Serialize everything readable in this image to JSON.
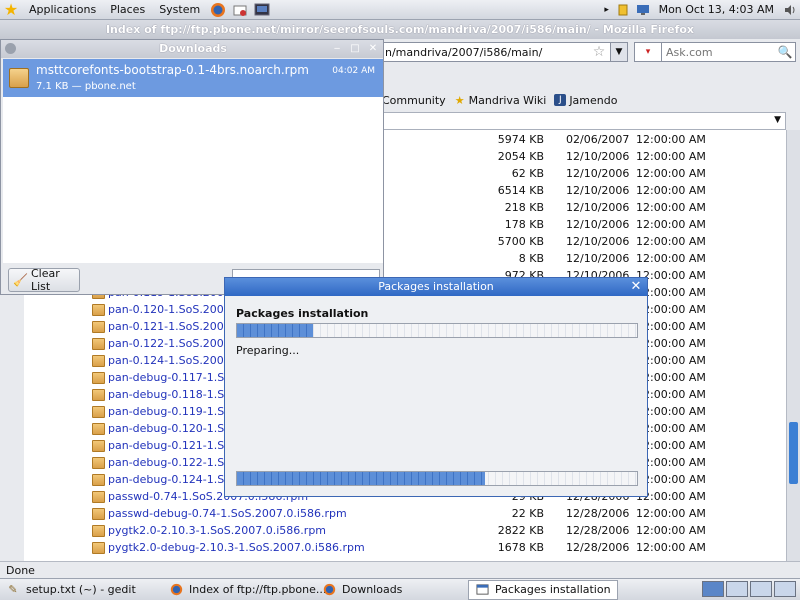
{
  "top_panel": {
    "menus": [
      "Applications",
      "Places",
      "System"
    ],
    "clock": "Mon Oct 13,  4:03 AM"
  },
  "firefox": {
    "title": "Index of ftp://ftp.pbone.net/mirror/seerofsouls.com/mandriva/2007/i586/main/ - Mozilla Firefox",
    "url": "n/mandriva/2007/i586/main/",
    "search_placeholder": "Ask.com",
    "bookmarks": [
      "Community",
      "Mandriva Wiki",
      "Jamendo"
    ],
    "status": "Done",
    "rows": [
      {
        "name": "",
        "size": "5974 KB",
        "date": "02/06/2007",
        "time": "12:00:00 AM"
      },
      {
        "name": "",
        "size": "2054 KB",
        "date": "12/10/2006",
        "time": "12:00:00 AM"
      },
      {
        "name": "",
        "size": "62 KB",
        "date": "12/10/2006",
        "time": "12:00:00 AM"
      },
      {
        "name": "",
        "size": "6514 KB",
        "date": "12/10/2006",
        "time": "12:00:00 AM"
      },
      {
        "name": "",
        "size": "218 KB",
        "date": "12/10/2006",
        "time": "12:00:00 AM"
      },
      {
        "name": "",
        "size": "178 KB",
        "date": "12/10/2006",
        "time": "12:00:00 AM"
      },
      {
        "name": "",
        "size": "5700 KB",
        "date": "12/10/2006",
        "time": "12:00:00 AM"
      },
      {
        "name": "",
        "size": "8 KB",
        "date": "12/10/2006",
        "time": "12:00:00 AM"
      },
      {
        "name": "",
        "size": "972 KB",
        "date": "12/10/2006",
        "time": "12:00:00 AM"
      },
      {
        "name": "pan-0.119-1.SoS.2007.",
        "size": "",
        "date": "",
        "time": "12:00:00 AM"
      },
      {
        "name": "pan-0.120-1.SoS.2007.",
        "size": "",
        "date": "",
        "time": "12:00:00 AM"
      },
      {
        "name": "pan-0.121-1.SoS.2007.",
        "size": "",
        "date": "",
        "time": "12:00:00 AM"
      },
      {
        "name": "pan-0.122-1.SoS.2007.",
        "size": "",
        "date": "",
        "time": "12:00:00 AM"
      },
      {
        "name": "pan-0.124-1.SoS.2007.",
        "size": "",
        "date": "",
        "time": "12:00:00 AM"
      },
      {
        "name": "pan-debug-0.117-1.SoS.",
        "size": "",
        "date": "",
        "time": "12:00:00 AM"
      },
      {
        "name": "pan-debug-0.118-1.SoS.",
        "size": "",
        "date": "",
        "time": "12:00:00 AM"
      },
      {
        "name": "pan-debug-0.119-1.SoS.",
        "size": "",
        "date": "",
        "time": "12:00:00 AM"
      },
      {
        "name": "pan-debug-0.120-1.SoS.",
        "size": "",
        "date": "",
        "time": "12:00:00 AM"
      },
      {
        "name": "pan-debug-0.121-1.SoS.",
        "size": "",
        "date": "",
        "time": "12:00:00 AM"
      },
      {
        "name": "pan-debug-0.122-1.SoS.",
        "size": "",
        "date": "",
        "time": "12:00:00 AM"
      },
      {
        "name": "pan-debug-0.124-1.SoS.",
        "size": "",
        "date": "",
        "time": "12:00:00 AM"
      },
      {
        "name": "passwd-0.74-1.SoS.2007.0.i586.rpm",
        "size": "29 KB",
        "date": "12/28/2006",
        "time": "12:00:00 AM"
      },
      {
        "name": "passwd-debug-0.74-1.SoS.2007.0.i586.rpm",
        "size": "22 KB",
        "date": "12/28/2006",
        "time": "12:00:00 AM"
      },
      {
        "name": "pygtk2.0-2.10.3-1.SoS.2007.0.i586.rpm",
        "size": "2822 KB",
        "date": "12/28/2006",
        "time": "12:00:00 AM"
      },
      {
        "name": "pygtk2.0-debug-2.10.3-1.SoS.2007.0.i586.rpm",
        "size": "1678 KB",
        "date": "12/28/2006",
        "time": "12:00:00 AM"
      }
    ]
  },
  "downloads": {
    "title": "Downloads",
    "item_name": "msttcorefonts-bootstrap-0.1-4brs.noarch.rpm",
    "item_meta": "7.1 KB — pbone.net",
    "item_time": "04:02 AM",
    "clear_label": "Clear List"
  },
  "pkg_dialog": {
    "title": "Packages installation",
    "heading": "Packages installation",
    "status": "Preparing...",
    "progress_top": 0.19,
    "progress_bottom": 0.62
  },
  "taskbar": {
    "tasks": [
      "setup.txt (~) - gedit",
      "Index of ftp://ftp.pbone...",
      "Downloads",
      "Packages installation"
    ]
  },
  "colors": {
    "accent": "#3b7fd4",
    "link": "#2233bb",
    "selection": "#6d9ae0"
  }
}
